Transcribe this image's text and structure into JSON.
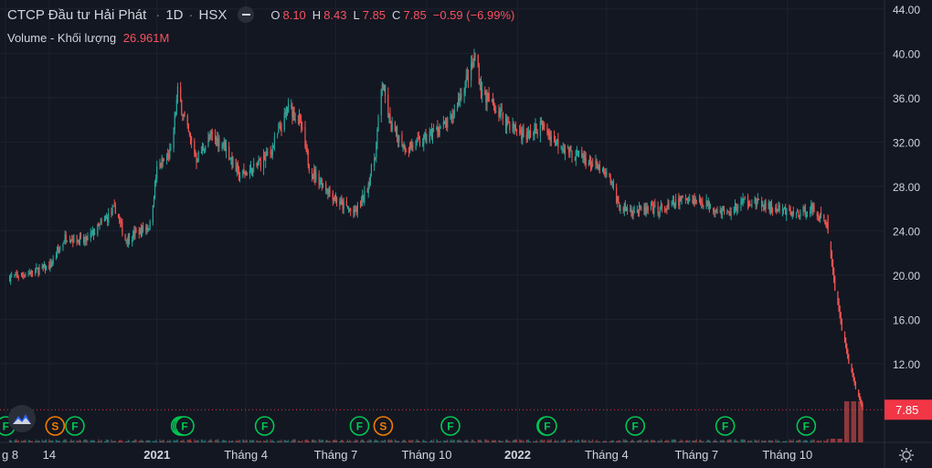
{
  "header": {
    "symbol": "CTCP Đầu tư Hải Phát",
    "interval": "1D",
    "exchange": "HSX",
    "ohlc": {
      "o_label": "O",
      "o": "8.10",
      "h_label": "H",
      "h": "8.43",
      "l_label": "L",
      "l": "7.85",
      "c_label": "C",
      "c": "7.85",
      "change": "−0.59 (−6.99%)"
    },
    "volume_label": "Volume - Khối lượng",
    "volume_value": "26.961M"
  },
  "colors": {
    "up": "#26a69a",
    "down": "#ef5350",
    "background": "#131722",
    "grid": "#1e222d",
    "axis_text": "#d1d4dc",
    "last_price": "#f23645",
    "split_marker": "#f57c00",
    "dividend_marker": "#00c853"
  },
  "icons": [
    "eye-toggle-icon",
    "tradingview-logo-icon",
    "settings-gear-icon"
  ],
  "chart_data": {
    "type": "candlestick",
    "title": "CTCP Đầu tư Hải Phát",
    "y_axis": {
      "ticks": [
        "44.00",
        "40.00",
        "36.00",
        "32.00",
        "28.00",
        "24.00",
        "20.00",
        "16.00",
        "12.00"
      ],
      "range": [
        4.9,
        44.4
      ],
      "position": "right"
    },
    "x_axis": {
      "ticks": [
        "g 8",
        "14",
        "2021",
        "Tháng 4",
        "Tháng 7",
        "Tháng 10",
        "2022",
        "Tháng 4",
        "Tháng 7",
        "Tháng 10"
      ],
      "bold_ticks": [
        "2021",
        "2022"
      ]
    },
    "last_price": {
      "value": 7.85,
      "label": "7.85"
    },
    "grid": true,
    "price_anchors": [
      {
        "date": "2020-08-05",
        "close": 19.8
      },
      {
        "date": "2020-08-25",
        "close": 20.2
      },
      {
        "date": "2020-09-15",
        "close": 20.8
      },
      {
        "date": "2020-10-01",
        "close": 23.5
      },
      {
        "date": "2020-10-20",
        "close": 23.0
      },
      {
        "date": "2020-11-05",
        "close": 24.5
      },
      {
        "date": "2020-11-20",
        "close": 26.0
      },
      {
        "date": "2020-11-30",
        "close": 23.2
      },
      {
        "date": "2020-12-15",
        "close": 24.0
      },
      {
        "date": "2020-12-25",
        "close": 24.5
      },
      {
        "date": "2021-01-01",
        "close": 29.5
      },
      {
        "date": "2021-01-15",
        "close": 31.0
      },
      {
        "date": "2021-01-22",
        "close": 36.5
      },
      {
        "date": "2021-02-01",
        "close": 33.0
      },
      {
        "date": "2021-02-10",
        "close": 30.5
      },
      {
        "date": "2021-02-25",
        "close": 32.5
      },
      {
        "date": "2021-03-10",
        "close": 31.8
      },
      {
        "date": "2021-03-25",
        "close": 29.0
      },
      {
        "date": "2021-04-08",
        "close": 29.5
      },
      {
        "date": "2021-04-25",
        "close": 31.0
      },
      {
        "date": "2021-05-05",
        "close": 33.0
      },
      {
        "date": "2021-05-15",
        "close": 35.2
      },
      {
        "date": "2021-05-25",
        "close": 34.0
      },
      {
        "date": "2021-06-05",
        "close": 29.5
      },
      {
        "date": "2021-06-20",
        "close": 28.0
      },
      {
        "date": "2021-07-05",
        "close": 26.5
      },
      {
        "date": "2021-07-20",
        "close": 25.5
      },
      {
        "date": "2021-08-01",
        "close": 27.5
      },
      {
        "date": "2021-08-10",
        "close": 31.0
      },
      {
        "date": "2021-08-17",
        "close": 37.5
      },
      {
        "date": "2021-08-25",
        "close": 33.5
      },
      {
        "date": "2021-09-10",
        "close": 31.5
      },
      {
        "date": "2021-09-25",
        "close": 32.0
      },
      {
        "date": "2021-10-10",
        "close": 33.0
      },
      {
        "date": "2021-10-25",
        "close": 33.8
      },
      {
        "date": "2021-11-05",
        "close": 36.5
      },
      {
        "date": "2021-11-15",
        "close": 38.5
      },
      {
        "date": "2021-11-20",
        "close": 40.0
      },
      {
        "date": "2021-11-25",
        "close": 36.5
      },
      {
        "date": "2021-12-10",
        "close": 35.0
      },
      {
        "date": "2021-12-25",
        "close": 33.5
      },
      {
        "date": "2022-01-10",
        "close": 32.5
      },
      {
        "date": "2022-01-25",
        "close": 33.5
      },
      {
        "date": "2022-02-10",
        "close": 32.0
      },
      {
        "date": "2022-02-25",
        "close": 31.0
      },
      {
        "date": "2022-03-10",
        "close": 30.5
      },
      {
        "date": "2022-03-25",
        "close": 29.5
      },
      {
        "date": "2022-04-05",
        "close": 28.5
      },
      {
        "date": "2022-04-15",
        "close": 26.0
      },
      {
        "date": "2022-05-10",
        "close": 25.8
      },
      {
        "date": "2022-06-01",
        "close": 26.0
      },
      {
        "date": "2022-06-20",
        "close": 27.0
      },
      {
        "date": "2022-07-10",
        "close": 26.5
      },
      {
        "date": "2022-08-01",
        "close": 25.5
      },
      {
        "date": "2022-08-20",
        "close": 26.8
      },
      {
        "date": "2022-09-15",
        "close": 26.0
      },
      {
        "date": "2022-10-10",
        "close": 25.5
      },
      {
        "date": "2022-10-25",
        "close": 26.0
      },
      {
        "date": "2022-11-01",
        "close": 25.5
      },
      {
        "date": "2022-11-10",
        "close": 24.5
      },
      {
        "date": "2022-11-12",
        "close": 23.0
      },
      {
        "date": "2022-11-14",
        "close": 21.5
      },
      {
        "date": "2022-11-16",
        "close": 20.0
      },
      {
        "date": "2022-11-18",
        "close": 18.6
      },
      {
        "date": "2022-11-21",
        "close": 17.3
      },
      {
        "date": "2022-11-23",
        "close": 16.1
      },
      {
        "date": "2022-11-25",
        "close": 15.0
      },
      {
        "date": "2022-11-28",
        "close": 13.9
      },
      {
        "date": "2022-11-30",
        "close": 12.9
      },
      {
        "date": "2022-12-02",
        "close": 12.0
      },
      {
        "date": "2022-12-05",
        "close": 11.2
      },
      {
        "date": "2022-12-07",
        "close": 10.4
      },
      {
        "date": "2022-12-09",
        "close": 9.7
      },
      {
        "date": "2022-12-12",
        "close": 9.0
      },
      {
        "date": "2022-12-14",
        "close": 8.4
      },
      {
        "date": "2022-12-16",
        "close": 7.85
      }
    ],
    "volume_spike": {
      "date": "2022-11-30",
      "label": "high volume near bottom"
    },
    "event_markers": [
      {
        "date": "2020-08-01",
        "label": "F"
      },
      {
        "date": "2020-09-20",
        "label": "S"
      },
      {
        "date": "2020-10-10",
        "label": "F"
      },
      {
        "date": "2021-01-25",
        "label": "F"
      },
      {
        "date": "2021-01-27",
        "label": "F"
      },
      {
        "date": "2021-01-29",
        "label": "F"
      },
      {
        "date": "2021-04-20",
        "label": "F"
      },
      {
        "date": "2021-07-25",
        "label": "F"
      },
      {
        "date": "2021-08-18",
        "label": "S"
      },
      {
        "date": "2021-10-25",
        "label": "F"
      },
      {
        "date": "2022-01-30",
        "label": "F"
      },
      {
        "date": "2022-01-31",
        "label": "F"
      },
      {
        "date": "2022-04-30",
        "label": "F"
      },
      {
        "date": "2022-07-30",
        "label": "F"
      },
      {
        "date": "2022-10-20",
        "label": "F"
      }
    ]
  }
}
